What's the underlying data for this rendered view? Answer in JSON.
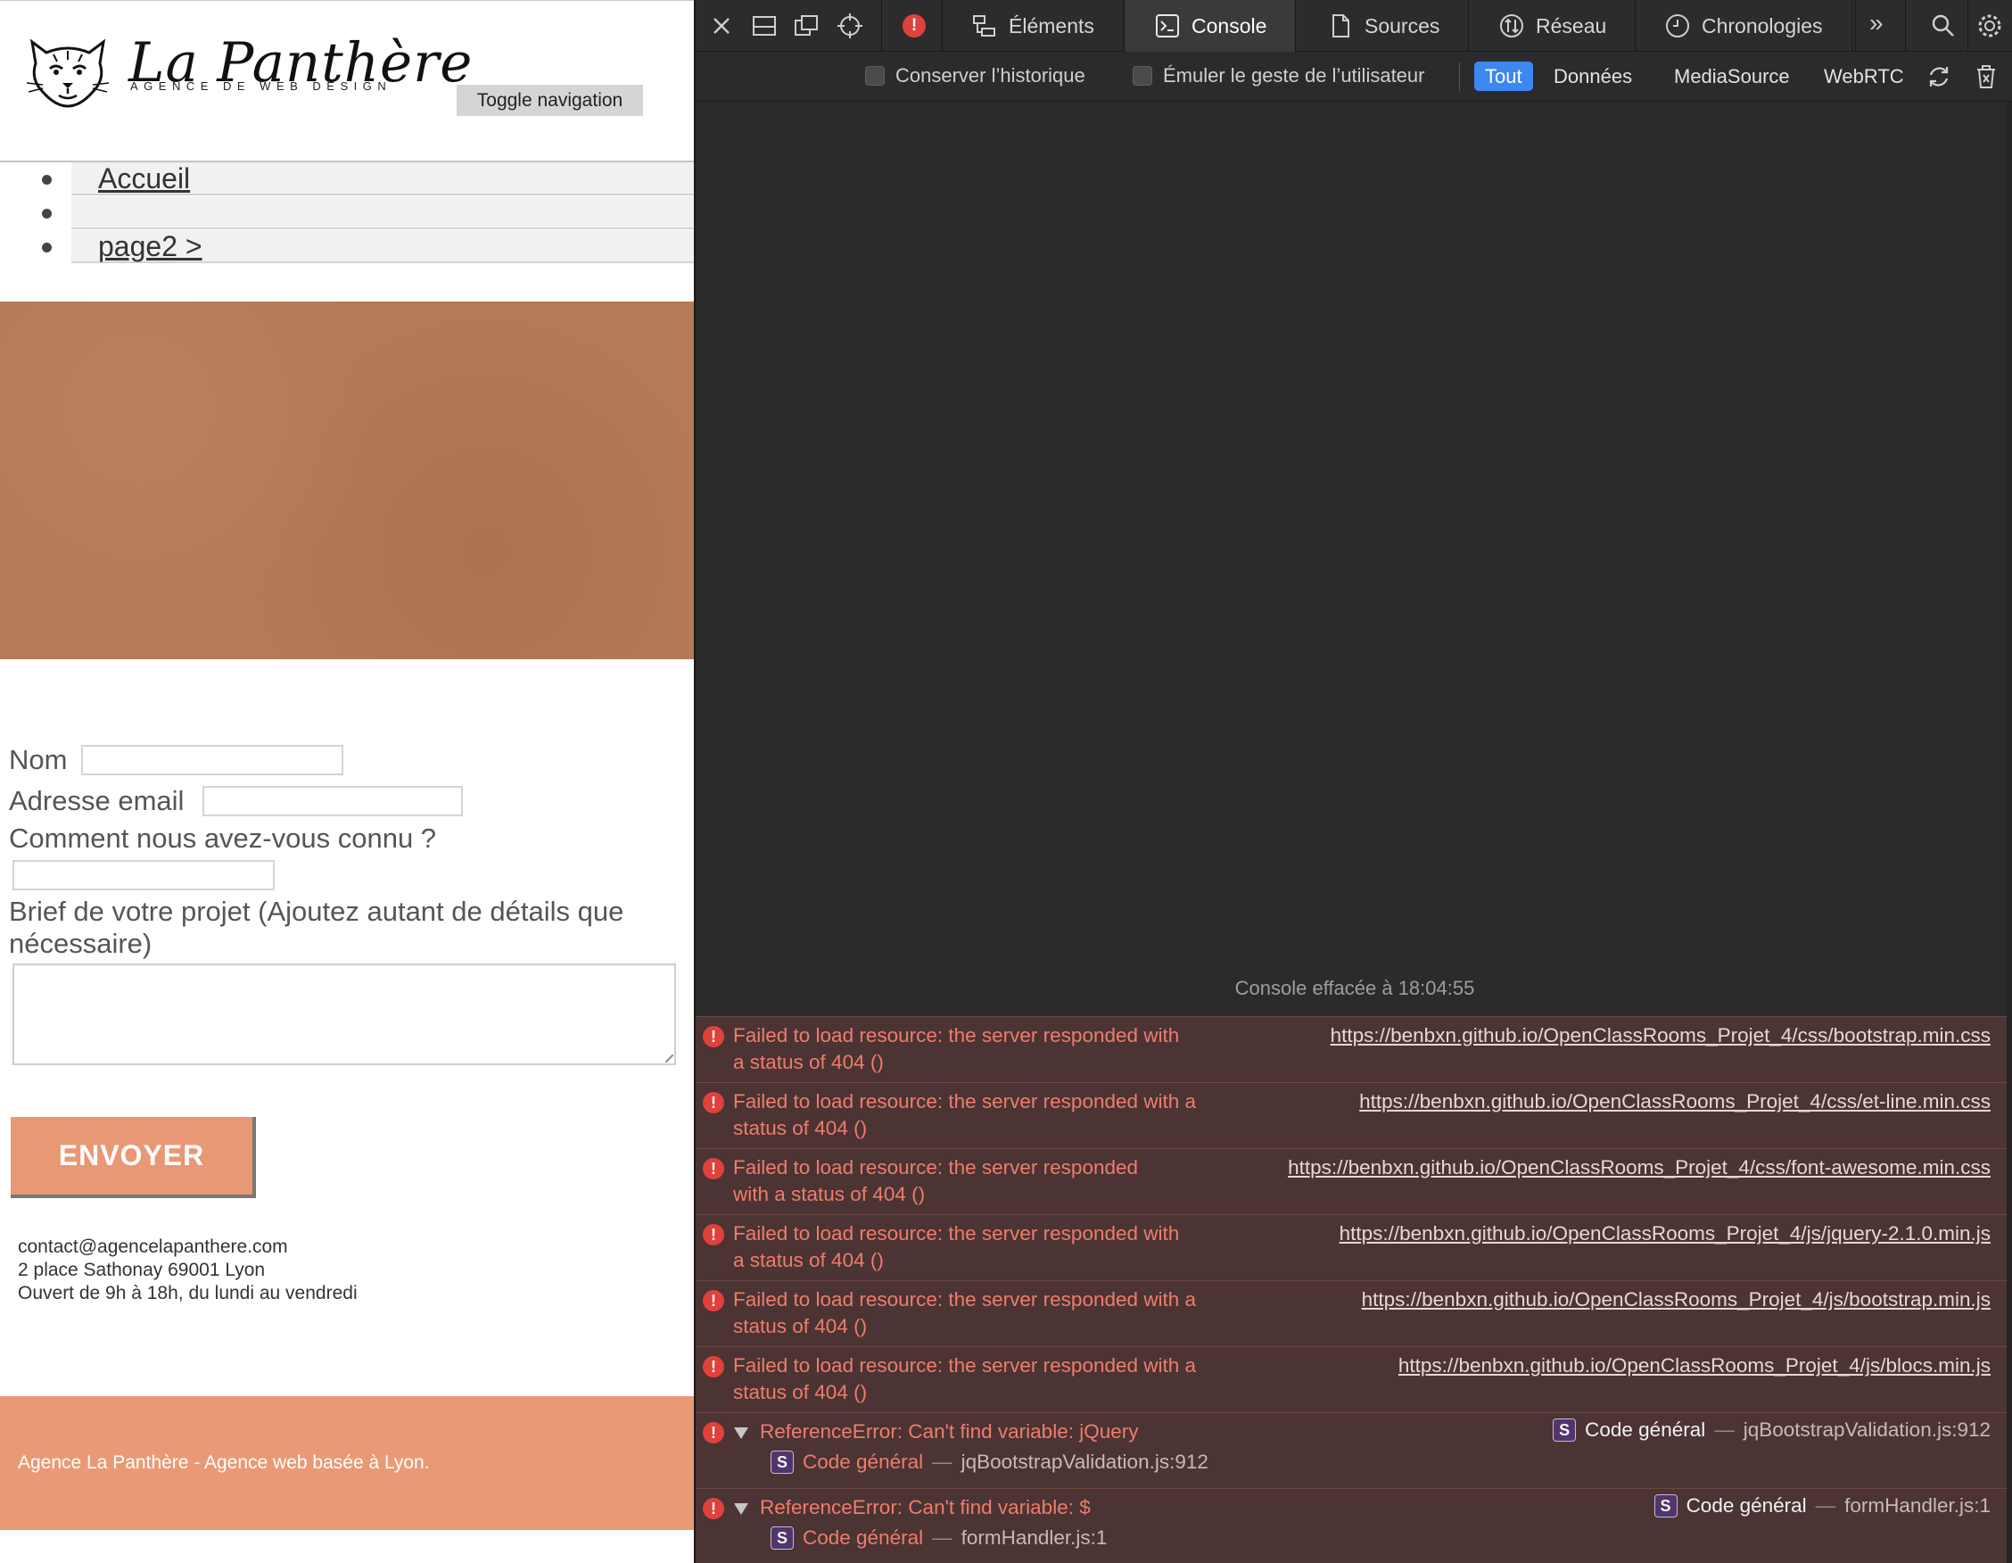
{
  "page": {
    "logo": {
      "title": "La Panthère",
      "subtitle": "AGENCE DE WEB DESIGN"
    },
    "toggle_nav_label": "Toggle navigation",
    "nav_items": [
      {
        "label": "Accueil"
      },
      {
        "label": ""
      },
      {
        "label": "page2 >"
      }
    ],
    "form": {
      "name_label": "Nom",
      "name_value": "",
      "email_label": "Adresse email",
      "email_value": "",
      "source_label": "Comment nous avez-vous connu ?",
      "source_value": "",
      "brief_label_line1": "Brief de votre projet (Ajoutez autant de détails que",
      "brief_label_line2": "nécessaire)",
      "brief_value": "",
      "submit_label": "ENVOYER"
    },
    "contact": {
      "email": "contact@agencelapanthere.com",
      "address": "2 place Sathonay 69001 Lyon",
      "hours": "Ouvert de 9h à 18h, du lundi au vendredi"
    },
    "footer_text": "Agence La Panthère - Agence web basée à Lyon.",
    "colors": {
      "accent": "#e89874",
      "hero": "#b57a56",
      "footer": "#e99a75"
    }
  },
  "devtools": {
    "tabs": [
      {
        "label": "Éléments",
        "icon": "elements-icon"
      },
      {
        "label": "Console",
        "icon": "console-icon",
        "active": true
      },
      {
        "label": "Sources",
        "icon": "sources-icon"
      },
      {
        "label": "Réseau",
        "icon": "network-icon"
      },
      {
        "label": "Chronologies",
        "icon": "timelines-icon"
      }
    ],
    "more_tabs_glyph": "»",
    "filters": {
      "preserve_log": "Conserver l’historique",
      "emulate_gesture": "Émuler le geste de l’utilisateur",
      "pills": [
        "Tout",
        "Données",
        "MediaSource",
        "WebRTC"
      ],
      "active_pill": "Tout"
    },
    "cleared_message": "Console effacée à 18:04:55",
    "messages": [
      {
        "line1": "Failed to load resource: the server responded with",
        "line2": "a status of 404 ()",
        "url": "https://benbxn.github.io/OpenClassRooms_Projet_4/css/bootstrap.min.css"
      },
      {
        "line1": "Failed to load resource: the server responded with a",
        "line2": "status of 404 ()",
        "url": "https://benbxn.github.io/OpenClassRooms_Projet_4/css/et-line.min.css"
      },
      {
        "line1": "Failed to load resource: the server responded",
        "line2": "with a status of 404 ()",
        "url": "https://benbxn.github.io/OpenClassRooms_Projet_4/css/font-awesome.min.css"
      },
      {
        "line1": "Failed to load resource: the server responded with",
        "line2": "a status of 404 ()",
        "url": "https://benbxn.github.io/OpenClassRooms_Projet_4/js/jquery-2.1.0.min.js"
      },
      {
        "line1": "Failed to load resource: the server responded with a",
        "line2": "status of 404 ()",
        "url": "https://benbxn.github.io/OpenClassRooms_Projet_4/js/bootstrap.min.js"
      },
      {
        "line1": "Failed to load resource: the server responded with a",
        "line2": "status of 404 ()",
        "url": "https://benbxn.github.io/OpenClassRooms_Projet_4/js/blocs.min.js"
      }
    ],
    "errors": [
      {
        "text": "ReferenceError: Can't find variable: jQuery",
        "badge": "S",
        "source_label": "Code général",
        "dash": "—",
        "file": "jqBootstrapValidation.js:912"
      },
      {
        "text": "ReferenceError: Can't find variable: $",
        "badge": "S",
        "source_label": "Code général",
        "dash": "—",
        "file": "formHandler.js:1"
      }
    ],
    "colors": {
      "error_text": "#ef7c6e",
      "error_bg": "#4b3433",
      "active_pill": "#3c87f0",
      "error_icon": "#e0413b"
    }
  }
}
